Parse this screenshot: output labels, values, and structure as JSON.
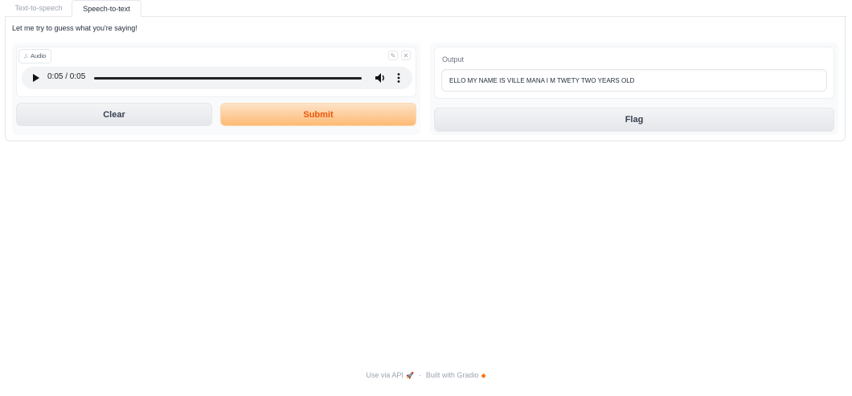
{
  "tabs": [
    {
      "label": "Text-to-speech",
      "active": false
    },
    {
      "label": "Speech-to-text",
      "active": true
    }
  ],
  "description": "Let me try to guess what you're saying!",
  "input": {
    "label": "Audio",
    "label_icon": "music-note-icon",
    "edit_icon": "pencil-icon",
    "clear_icon": "close-icon",
    "player": {
      "time": "0:05 / 0:05",
      "progress": 1.0
    }
  },
  "buttons": {
    "clear": "Clear",
    "submit": "Submit",
    "flag": "Flag"
  },
  "output": {
    "label": "Output",
    "value": "ELLO MY NAME IS VILLE MANA I M TWETY TWO YEARS OLD"
  },
  "footer": {
    "api": "Use via API",
    "separator": "·",
    "built": "Built with Gradio"
  },
  "colors": {
    "accent": "#ea580c",
    "submit_bg": "#fdba74"
  }
}
